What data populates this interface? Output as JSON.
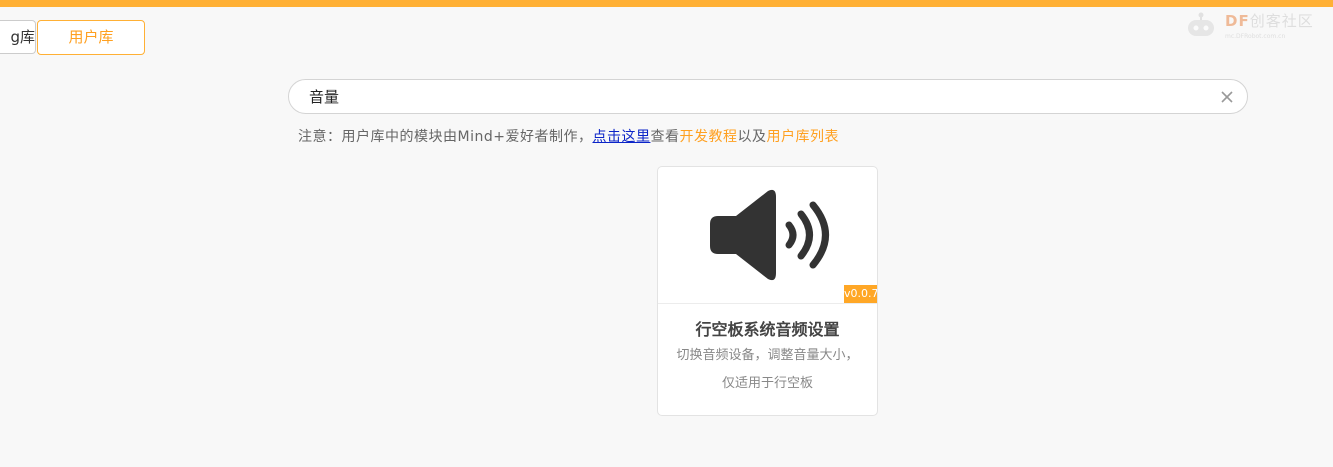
{
  "watermark": {
    "brand": "DF",
    "brand_cn": "创客社区",
    "sub": "mc.DFRobot.com.cn"
  },
  "tabs": {
    "partial_label": "g库",
    "user_library": "用户库"
  },
  "search": {
    "value": "音量",
    "clear_icon": "close-icon"
  },
  "notice": {
    "prefix": "注意：用户库中的模块由Mind+爱好者制作，",
    "link": "点击这里",
    "mid": "查看",
    "dev_tutorial": "开发教程",
    "and": "以及",
    "library_list": "用户库列表"
  },
  "card": {
    "icon": "speaker-volume-icon",
    "version": "v0.0.7",
    "title": "行空板系统音频设置",
    "desc_line1": "切换音频设备，调整音量大小，",
    "desc_line2": "仅适用于行空板"
  },
  "colors": {
    "accent": "#ffb035",
    "link": "#0b24c8",
    "highlight": "#ffa020"
  }
}
